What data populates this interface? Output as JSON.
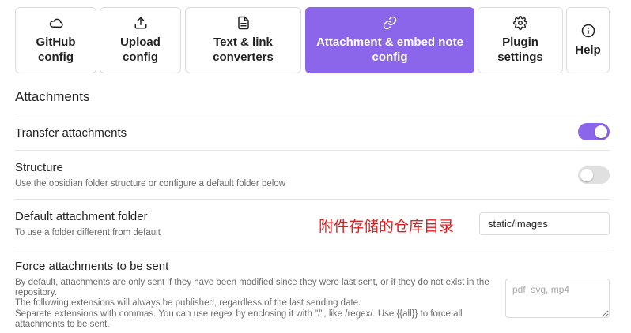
{
  "tabs": [
    {
      "id": "github",
      "label": "GitHub\nconfig",
      "icon": "cloud-icon",
      "active": false
    },
    {
      "id": "upload",
      "label": "Upload\nconfig",
      "icon": "upload-icon",
      "active": false
    },
    {
      "id": "converters",
      "label": "Text & link\nconverters",
      "icon": "file-text-icon",
      "active": false
    },
    {
      "id": "attachment",
      "label": "Attachment & embed note\nconfig",
      "icon": "link-icon",
      "active": true
    },
    {
      "id": "plugin",
      "label": "Plugin\nsettings",
      "icon": "gear-icon",
      "active": false
    },
    {
      "id": "help",
      "label": "Help",
      "icon": "info-icon",
      "active": false
    }
  ],
  "section": {
    "title": "Attachments"
  },
  "settings": {
    "transfer": {
      "name": "Transfer attachments",
      "enabled": true
    },
    "structure": {
      "name": "Structure",
      "desc": "Use the obsidian folder structure or configure a default folder below",
      "enabled": false
    },
    "folder": {
      "name": "Default attachment folder",
      "desc": "To use a folder different from default",
      "value": "static/images",
      "annotation": "附件存储的仓库目录"
    },
    "force": {
      "name": "Force attachments to be sent",
      "desc_lines": [
        "By default, attachments are only sent if they have been modified since they were last sent, or if they do not exist in the repository.",
        "The following extensions will always be published, regardless of the last sending date.",
        "Separate extensions with commas. You can use regex by enclosing it with \"/\", like /regex/. Use {{all}} to force all attachments to be sent."
      ],
      "placeholder": "pdf, svg, mp4"
    }
  },
  "colors": {
    "accent": "#8c66ea",
    "annotation": "#e02020"
  }
}
